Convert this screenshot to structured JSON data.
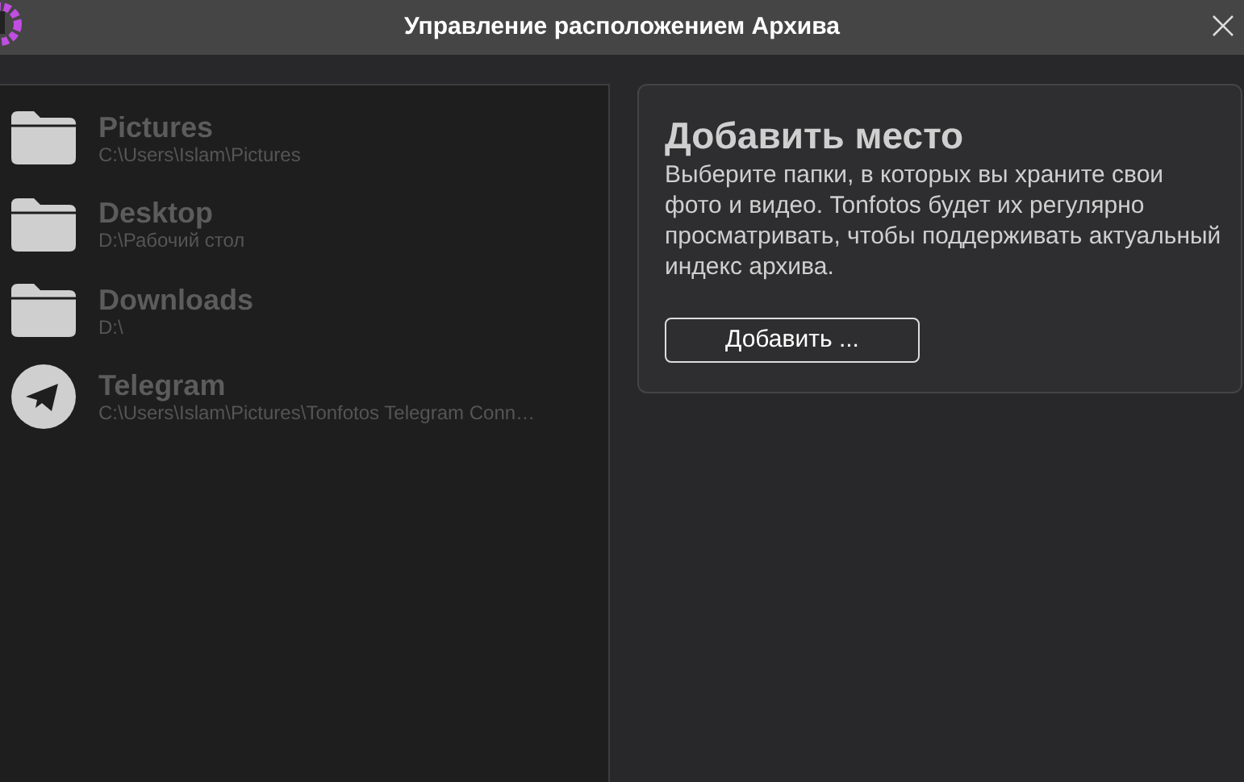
{
  "window": {
    "title": "Управление расположением Архива"
  },
  "locations": [
    {
      "kind": "folder",
      "name": "Pictures",
      "path": "C:\\Users\\Islam\\Pictures"
    },
    {
      "kind": "folder",
      "name": "Desktop",
      "path": "D:\\Рабочий стол"
    },
    {
      "kind": "folder",
      "name": "Downloads",
      "path": "D:\\"
    },
    {
      "kind": "telegram",
      "name": "Telegram",
      "path": "C:\\Users\\Islam\\Pictures\\Tonfotos Telegram Conn…"
    }
  ],
  "add_card": {
    "heading": "Добавить место",
    "description": "Выберите папки, в которых вы храните свои фото и видео. Tonfotos будет их регулярно просматривать, чтобы поддерживать актуальный индекс архива.",
    "button": "Добавить ..."
  }
}
